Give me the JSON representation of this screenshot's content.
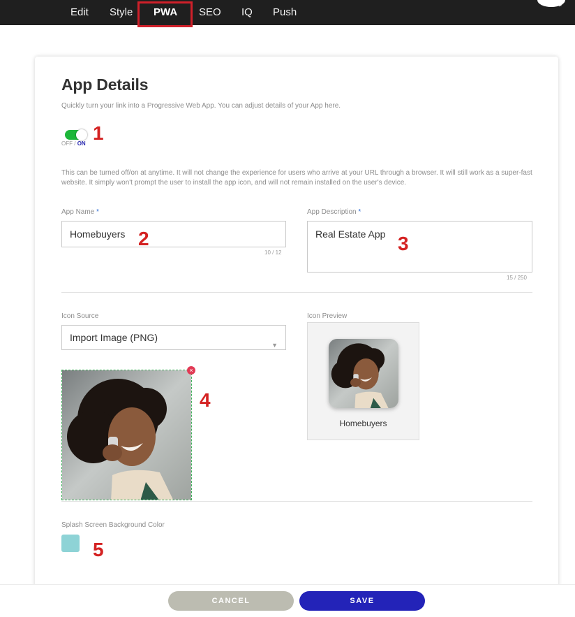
{
  "nav": {
    "tabs": [
      {
        "label": "Edit"
      },
      {
        "label": "Style"
      },
      {
        "label": "PWA"
      },
      {
        "label": "SEO"
      },
      {
        "label": "IQ"
      },
      {
        "label": "Push"
      }
    ],
    "active_tab": "PWA"
  },
  "app_details": {
    "title": "App Details",
    "subtitle": "Quickly turn your link into a Progressive Web App. You can adjust details of your App here.",
    "toggle": {
      "off_label": "OFF",
      "separator": "/",
      "on_label": "ON",
      "state": "on"
    },
    "note": "This can be turned off/on at anytime. It will not change the experience for users who arrive at your URL through a browser. It will still work as a super-fast website. It simply won't prompt the user to install the app icon, and will not remain installed on the user's device."
  },
  "fields": {
    "app_name": {
      "label": "App Name",
      "required_mark": "*",
      "value": "Homebuyers",
      "counter": "10 / 12"
    },
    "app_description": {
      "label": "App Description",
      "required_mark": "*",
      "value": "Real Estate App",
      "counter": "15 / 250"
    },
    "icon_source": {
      "label": "Icon Source",
      "value": "Import Image (PNG)"
    },
    "icon_preview": {
      "label": "Icon Preview",
      "app_name": "Homebuyers"
    },
    "splash": {
      "label": "Splash Screen Background Color",
      "color": "#8ed3d6"
    }
  },
  "annotations": [
    "1",
    "2",
    "3",
    "4",
    "5"
  ],
  "footer": {
    "cancel_label": "CANCEL",
    "save_label": "SAVE"
  },
  "colors": {
    "toggle_on": "#1db73a",
    "save_button": "#2323b8",
    "cancel_button": "#bcbcb1",
    "annotation_red": "#d42222",
    "highlight_border": "#d0202a"
  },
  "icons": {
    "remove": "close-circle-icon",
    "select": "caret-down-icon",
    "settings": "gear-icon"
  }
}
